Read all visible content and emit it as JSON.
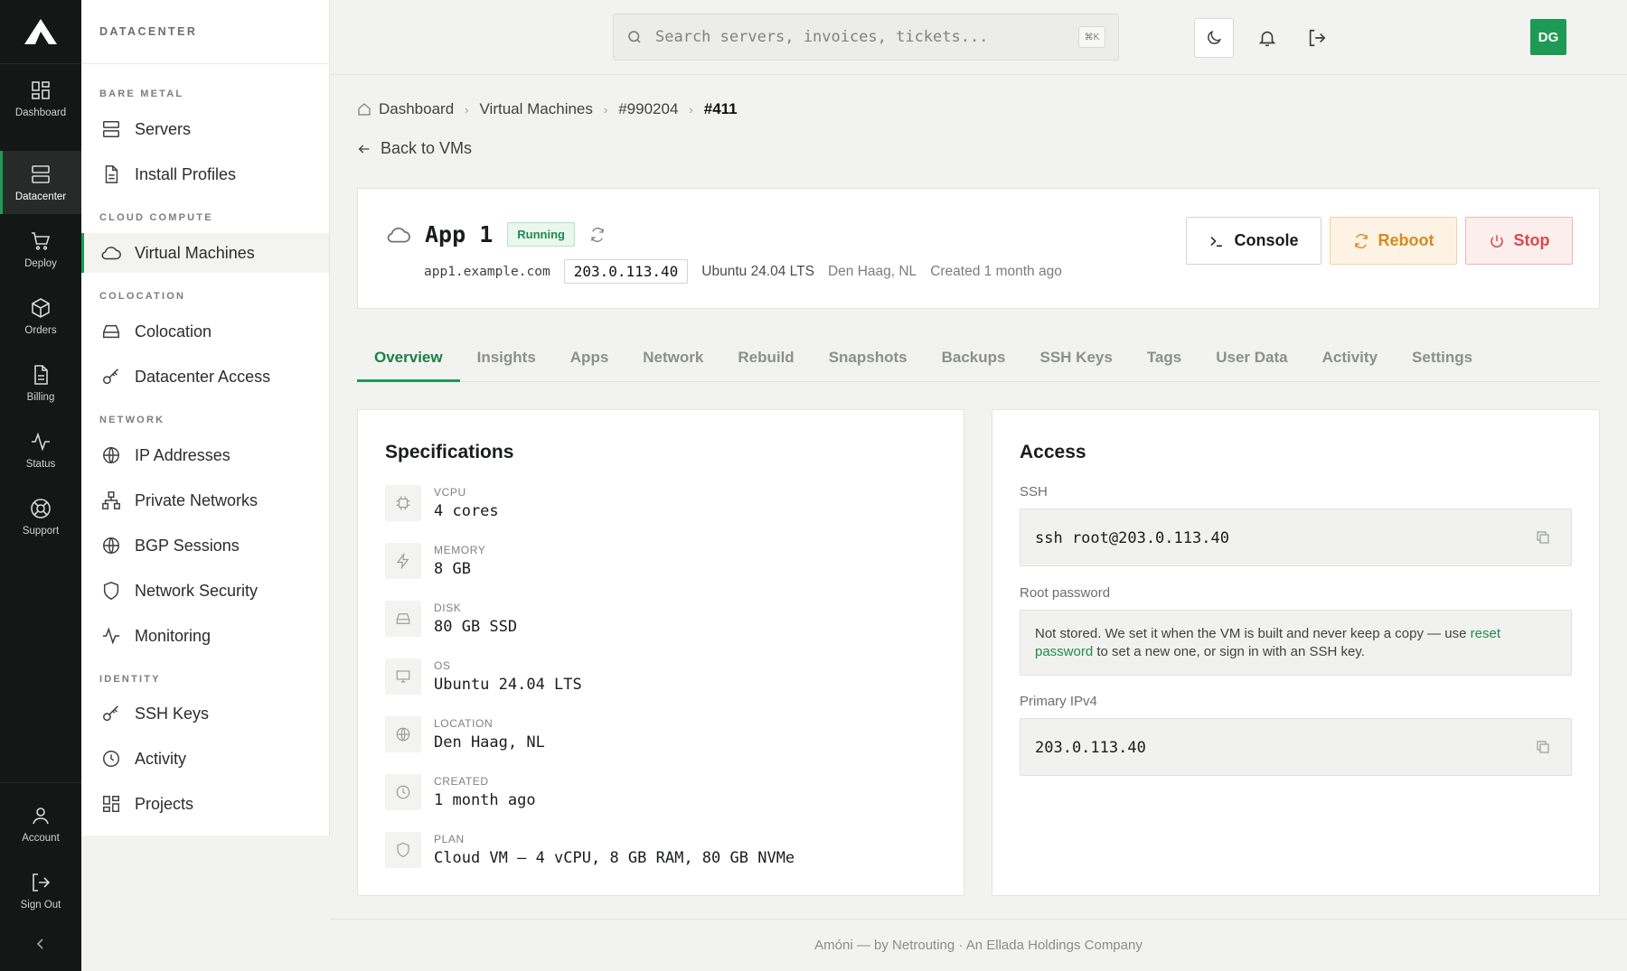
{
  "rail": {
    "items": [
      {
        "label": "Dashboard",
        "icon": "grid-icon"
      },
      {
        "label": "Datacenter",
        "icon": "server-icon"
      },
      {
        "label": "Deploy",
        "icon": "cart-icon"
      },
      {
        "label": "Orders",
        "icon": "box-icon"
      },
      {
        "label": "Billing",
        "icon": "document-icon"
      },
      {
        "label": "Status",
        "icon": "pulse-icon"
      },
      {
        "label": "Support",
        "icon": "lifebuoy-icon"
      }
    ],
    "bottom": [
      {
        "label": "Account",
        "icon": "user-icon"
      },
      {
        "label": "Sign Out",
        "icon": "sign-out-icon"
      }
    ]
  },
  "sidebar": {
    "title": "DATACENTER",
    "sections": [
      {
        "title": "BARE METAL",
        "items": [
          "Servers",
          "Install Profiles"
        ]
      },
      {
        "title": "CLOUD COMPUTE",
        "items": [
          "Virtual Machines"
        ]
      },
      {
        "title": "COLOCATION",
        "items": [
          "Colocation",
          "Datacenter Access"
        ]
      },
      {
        "title": "NETWORK",
        "items": [
          "IP Addresses",
          "Private Networks",
          "BGP Sessions",
          "Network Security",
          "Monitoring"
        ]
      },
      {
        "title": "IDENTITY",
        "items": [
          "SSH Keys",
          "Activity",
          "Projects"
        ]
      }
    ],
    "active_item": "Virtual Machines"
  },
  "header": {
    "search_placeholder": "Search servers, invoices, tickets...",
    "search_shortcut": "⌘K",
    "avatar_initials": "DG"
  },
  "breadcrumb": [
    "Dashboard",
    "Virtual Machines",
    "#990204",
    "#411"
  ],
  "back_label": "Back to VMs",
  "vm": {
    "name": "App 1",
    "status": "Running",
    "hostname": "app1.example.com",
    "ip": "203.0.113.40",
    "os": "Ubuntu 24.04 LTS",
    "location": "Den Haag, NL",
    "created": "Created 1 month ago",
    "actions": {
      "console": "Console",
      "reboot": "Reboot",
      "stop": "Stop"
    }
  },
  "tabs": [
    "Overview",
    "Insights",
    "Apps",
    "Network",
    "Rebuild",
    "Snapshots",
    "Backups",
    "SSH Keys",
    "Tags",
    "User Data",
    "Activity",
    "Settings"
  ],
  "active_tab": "Overview",
  "specs": {
    "title": "Specifications",
    "items": [
      {
        "key": "VCPU",
        "value": "4 cores",
        "icon": "cpu-icon"
      },
      {
        "key": "MEMORY",
        "value": "8 GB",
        "icon": "bolt-icon"
      },
      {
        "key": "DISK",
        "value": "80 GB SSD",
        "icon": "disk-icon"
      },
      {
        "key": "OS",
        "value": "Ubuntu 24.04 LTS",
        "icon": "monitor-icon"
      },
      {
        "key": "LOCATION",
        "value": "Den Haag, NL",
        "icon": "globe-icon"
      },
      {
        "key": "CREATED",
        "value": "1 month ago",
        "icon": "clock-icon"
      },
      {
        "key": "PLAN",
        "value": "Cloud VM — 4 vCPU, 8 GB RAM, 80 GB NVMe",
        "icon": "shield-icon"
      }
    ]
  },
  "access": {
    "title": "Access",
    "ssh_label": "SSH",
    "ssh_command": "ssh root@203.0.113.40",
    "password_label": "Root password",
    "password_note_1": "Not stored. We set it when the VM is built and never keep a copy — use",
    "password_link": "reset password",
    "password_note_2": "to set a new one, or sign in with an SSH key.",
    "ipv4_label": "Primary IPv4",
    "ipv4": "203.0.113.40"
  },
  "footer": "Amóni — by Netrouting · An Ellada Holdings Company",
  "colors": {
    "accent": "#1f9a55",
    "rail_bg": "#141716",
    "reboot": "#d58a1e",
    "stop": "#d8494b"
  }
}
